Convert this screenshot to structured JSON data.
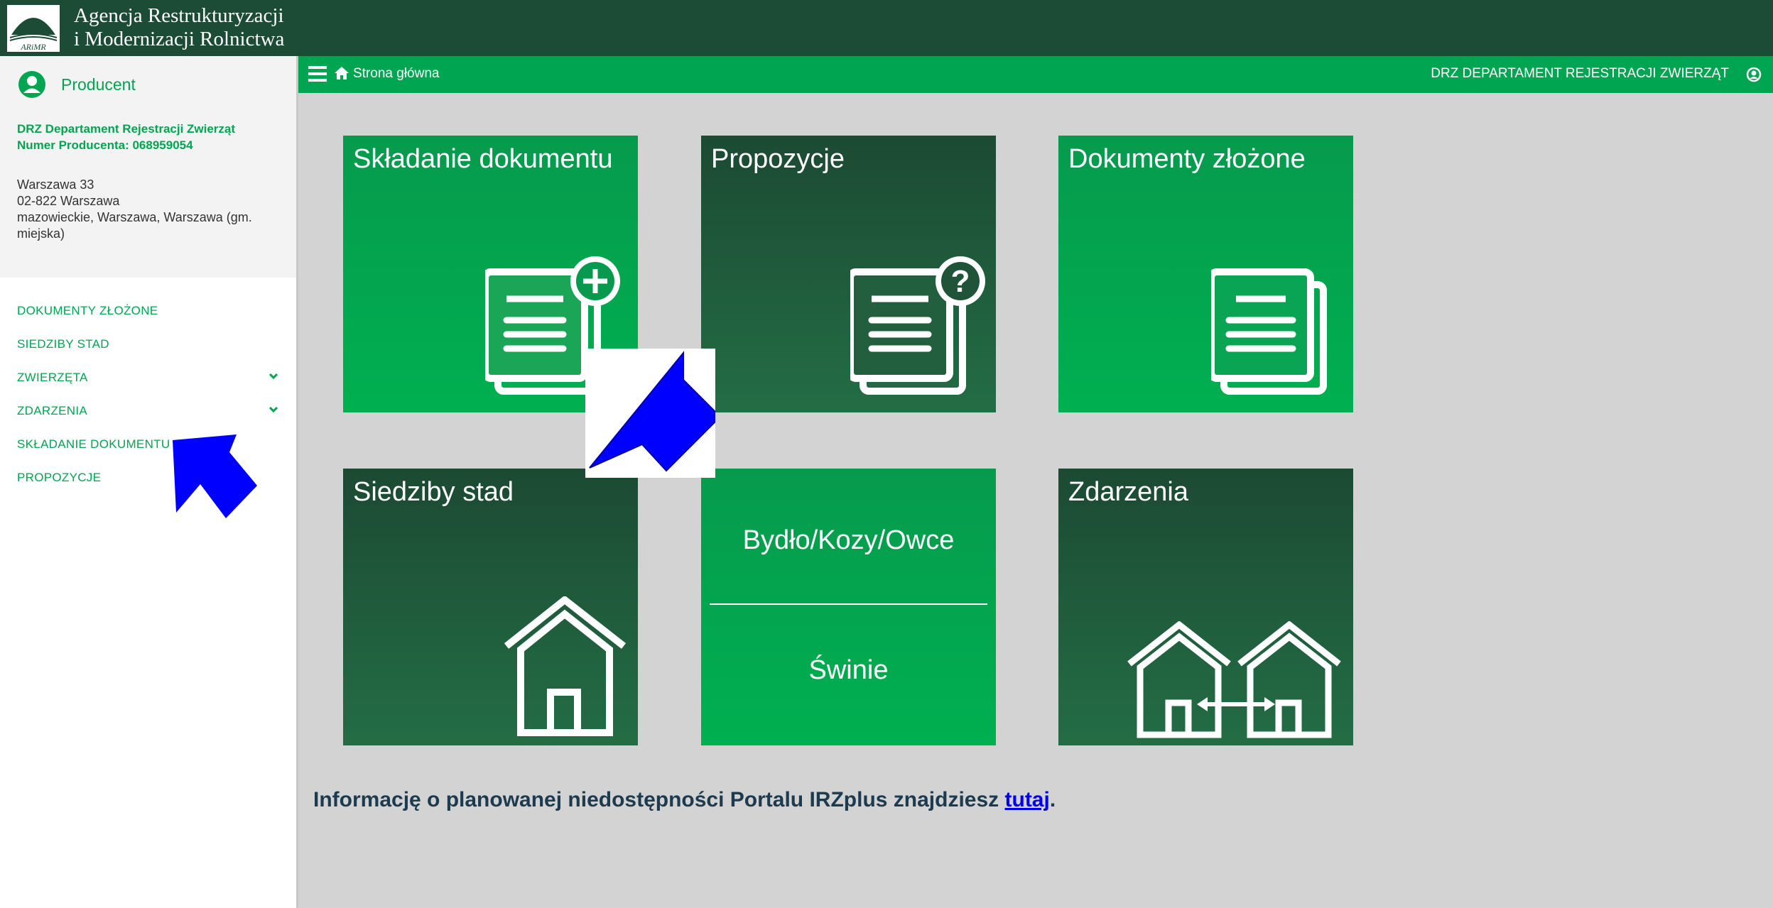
{
  "header": {
    "logo_line1": "Agencja Restrukturyzacji",
    "logo_line2": "i Modernizacji Rolnictwa",
    "logo_abbr": "ARiMR"
  },
  "navbar": {
    "home_label": "Strona główna",
    "department": "DRZ DEPARTAMENT REJESTRACJI ZWIERZĄT"
  },
  "sidebar": {
    "profile_title": "Producent",
    "producer_name": "DRZ Departament Rejestracji Zwierząt",
    "producer_number": "Numer Producenta: 068959054",
    "address_line1": "Warszawa 33",
    "address_line2": "02-822 Warszawa",
    "address_line3": "mazowieckie, Warszawa, Warszawa (gm. miejska)",
    "items": [
      {
        "label": "DOKUMENTY ZŁOŻONE"
      },
      {
        "label": "SIEDZIBY STAD"
      },
      {
        "label": "ZWIERZĘTA"
      },
      {
        "label": "ZDARZENIA"
      },
      {
        "label": "SKŁADANIE DOKUMENTU"
      },
      {
        "label": "PROPOZYCJE"
      }
    ]
  },
  "tiles": {
    "skladanie": "Składanie dokumentu",
    "propozycje": "Propozycje",
    "dokumenty": "Dokumenty złożone",
    "siedziby": "Siedziby stad",
    "bydlo": "Bydło/Kozy/Owce",
    "swinie": "Świnie",
    "zdarzenia": "Zdarzenia"
  },
  "notice": {
    "text": "Informację o planowanej niedostępności Portalu IRZplus znajdziesz ",
    "link": "tutaj",
    "suffix": "."
  },
  "colors": {
    "header_bg": "#1d4c36",
    "nav_bg": "#00a551",
    "tile_bright": "#00b050",
    "tile_dark": "#1c4a33",
    "arrow": "#0000ff"
  }
}
